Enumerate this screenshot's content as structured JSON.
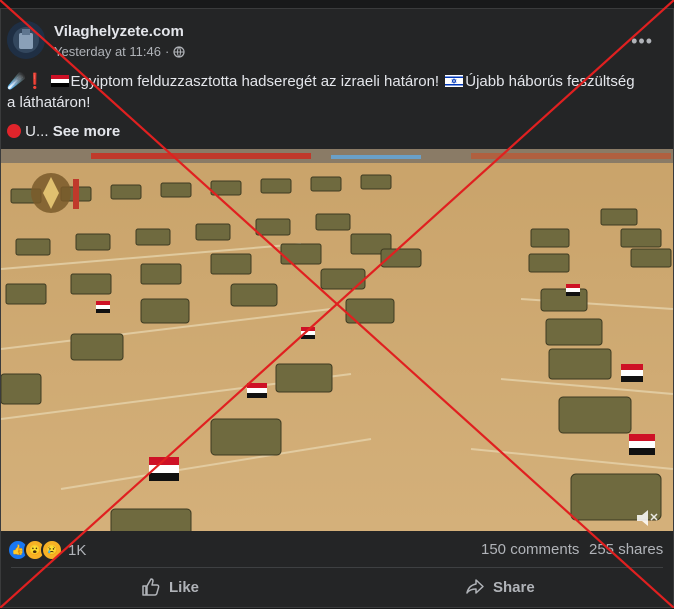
{
  "post": {
    "page_name": "Vilaghelyzete.com",
    "timestamp": "Yesterday at 11:46",
    "privacy_icon": "globe-icon",
    "more_icon": "more-options-icon",
    "text_part1": "Egyiptom felduzzasztotta hadseregét az izraeli határon!",
    "text_part2": "Újabb háborús feszültség a láthatáron!",
    "text_line2_prefix": "U...",
    "see_more": "See more"
  },
  "stats": {
    "reaction_count": "1K",
    "comments": "150 comments",
    "shares": "255 shares"
  },
  "actions": {
    "like": "Like",
    "share": "Share"
  },
  "colors": {
    "background": "#242526",
    "text": "#e4e6eb",
    "muted": "#b0b3b8",
    "cross": "#e02020"
  }
}
